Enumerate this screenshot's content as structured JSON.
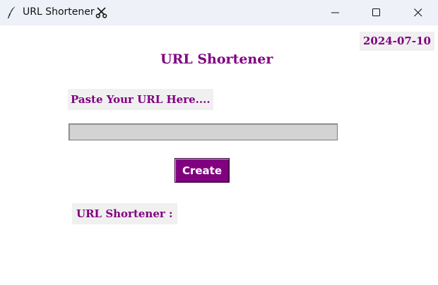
{
  "window": {
    "title": "URL Shortener",
    "icon": "feather-icon",
    "title_emoji": "scissors-icon",
    "controls": [
      "minimize-icon",
      "maximize-icon",
      "close-icon"
    ]
  },
  "app": {
    "date": "2024-07-10",
    "heading": "URL Shortener",
    "paste_label": "Paste Your URL Here....",
    "url_input": {
      "value": "",
      "placeholder": ""
    },
    "create_label": "Create",
    "result_label": "URL Shortener :"
  },
  "colors": {
    "accent": "#800080",
    "label_bg": "#f0f0f0",
    "input_bg": "#d3d3d3",
    "titlebar_bg": "#eef1f8",
    "button_text": "#ffffff"
  }
}
